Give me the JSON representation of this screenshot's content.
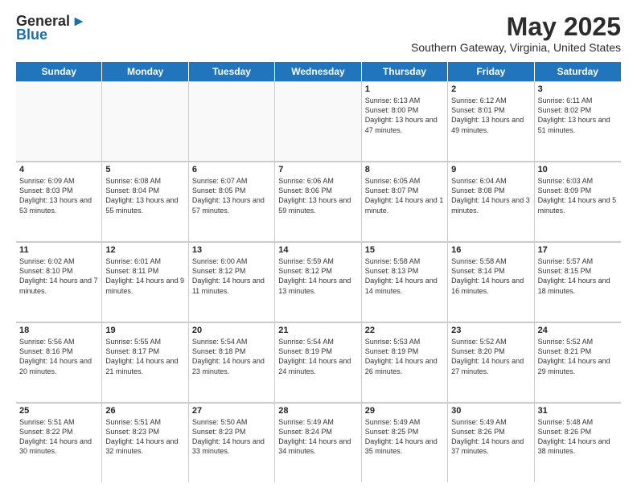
{
  "logo": {
    "general": "General",
    "blue": "Blue"
  },
  "header": {
    "month": "May 2025",
    "location": "Southern Gateway, Virginia, United States"
  },
  "days": [
    "Sunday",
    "Monday",
    "Tuesday",
    "Wednesday",
    "Thursday",
    "Friday",
    "Saturday"
  ],
  "rows": [
    [
      {
        "day": "",
        "empty": true
      },
      {
        "day": "",
        "empty": true
      },
      {
        "day": "",
        "empty": true
      },
      {
        "day": "",
        "empty": true
      },
      {
        "day": "1",
        "sunrise": "6:13 AM",
        "sunset": "8:00 PM",
        "daylight": "13 hours and 47 minutes."
      },
      {
        "day": "2",
        "sunrise": "6:12 AM",
        "sunset": "8:01 PM",
        "daylight": "13 hours and 49 minutes."
      },
      {
        "day": "3",
        "sunrise": "6:11 AM",
        "sunset": "8:02 PM",
        "daylight": "13 hours and 51 minutes."
      }
    ],
    [
      {
        "day": "4",
        "sunrise": "6:09 AM",
        "sunset": "8:03 PM",
        "daylight": "13 hours and 53 minutes."
      },
      {
        "day": "5",
        "sunrise": "6:08 AM",
        "sunset": "8:04 PM",
        "daylight": "13 hours and 55 minutes."
      },
      {
        "day": "6",
        "sunrise": "6:07 AM",
        "sunset": "8:05 PM",
        "daylight": "13 hours and 57 minutes."
      },
      {
        "day": "7",
        "sunrise": "6:06 AM",
        "sunset": "8:06 PM",
        "daylight": "13 hours and 59 minutes."
      },
      {
        "day": "8",
        "sunrise": "6:05 AM",
        "sunset": "8:07 PM",
        "daylight": "14 hours and 1 minute."
      },
      {
        "day": "9",
        "sunrise": "6:04 AM",
        "sunset": "8:08 PM",
        "daylight": "14 hours and 3 minutes."
      },
      {
        "day": "10",
        "sunrise": "6:03 AM",
        "sunset": "8:09 PM",
        "daylight": "14 hours and 5 minutes."
      }
    ],
    [
      {
        "day": "11",
        "sunrise": "6:02 AM",
        "sunset": "8:10 PM",
        "daylight": "14 hours and 7 minutes."
      },
      {
        "day": "12",
        "sunrise": "6:01 AM",
        "sunset": "8:11 PM",
        "daylight": "14 hours and 9 minutes."
      },
      {
        "day": "13",
        "sunrise": "6:00 AM",
        "sunset": "8:12 PM",
        "daylight": "14 hours and 11 minutes."
      },
      {
        "day": "14",
        "sunrise": "5:59 AM",
        "sunset": "8:12 PM",
        "daylight": "14 hours and 13 minutes."
      },
      {
        "day": "15",
        "sunrise": "5:58 AM",
        "sunset": "8:13 PM",
        "daylight": "14 hours and 14 minutes."
      },
      {
        "day": "16",
        "sunrise": "5:58 AM",
        "sunset": "8:14 PM",
        "daylight": "14 hours and 16 minutes."
      },
      {
        "day": "17",
        "sunrise": "5:57 AM",
        "sunset": "8:15 PM",
        "daylight": "14 hours and 18 minutes."
      }
    ],
    [
      {
        "day": "18",
        "sunrise": "5:56 AM",
        "sunset": "8:16 PM",
        "daylight": "14 hours and 20 minutes."
      },
      {
        "day": "19",
        "sunrise": "5:55 AM",
        "sunset": "8:17 PM",
        "daylight": "14 hours and 21 minutes."
      },
      {
        "day": "20",
        "sunrise": "5:54 AM",
        "sunset": "8:18 PM",
        "daylight": "14 hours and 23 minutes."
      },
      {
        "day": "21",
        "sunrise": "5:54 AM",
        "sunset": "8:19 PM",
        "daylight": "14 hours and 24 minutes."
      },
      {
        "day": "22",
        "sunrise": "5:53 AM",
        "sunset": "8:19 PM",
        "daylight": "14 hours and 26 minutes."
      },
      {
        "day": "23",
        "sunrise": "5:52 AM",
        "sunset": "8:20 PM",
        "daylight": "14 hours and 27 minutes."
      },
      {
        "day": "24",
        "sunrise": "5:52 AM",
        "sunset": "8:21 PM",
        "daylight": "14 hours and 29 minutes."
      }
    ],
    [
      {
        "day": "25",
        "sunrise": "5:51 AM",
        "sunset": "8:22 PM",
        "daylight": "14 hours and 30 minutes."
      },
      {
        "day": "26",
        "sunrise": "5:51 AM",
        "sunset": "8:23 PM",
        "daylight": "14 hours and 32 minutes."
      },
      {
        "day": "27",
        "sunrise": "5:50 AM",
        "sunset": "8:23 PM",
        "daylight": "14 hours and 33 minutes."
      },
      {
        "day": "28",
        "sunrise": "5:49 AM",
        "sunset": "8:24 PM",
        "daylight": "14 hours and 34 minutes."
      },
      {
        "day": "29",
        "sunrise": "5:49 AM",
        "sunset": "8:25 PM",
        "daylight": "14 hours and 35 minutes."
      },
      {
        "day": "30",
        "sunrise": "5:49 AM",
        "sunset": "8:26 PM",
        "daylight": "14 hours and 37 minutes."
      },
      {
        "day": "31",
        "sunrise": "5:48 AM",
        "sunset": "8:26 PM",
        "daylight": "14 hours and 38 minutes."
      }
    ]
  ]
}
